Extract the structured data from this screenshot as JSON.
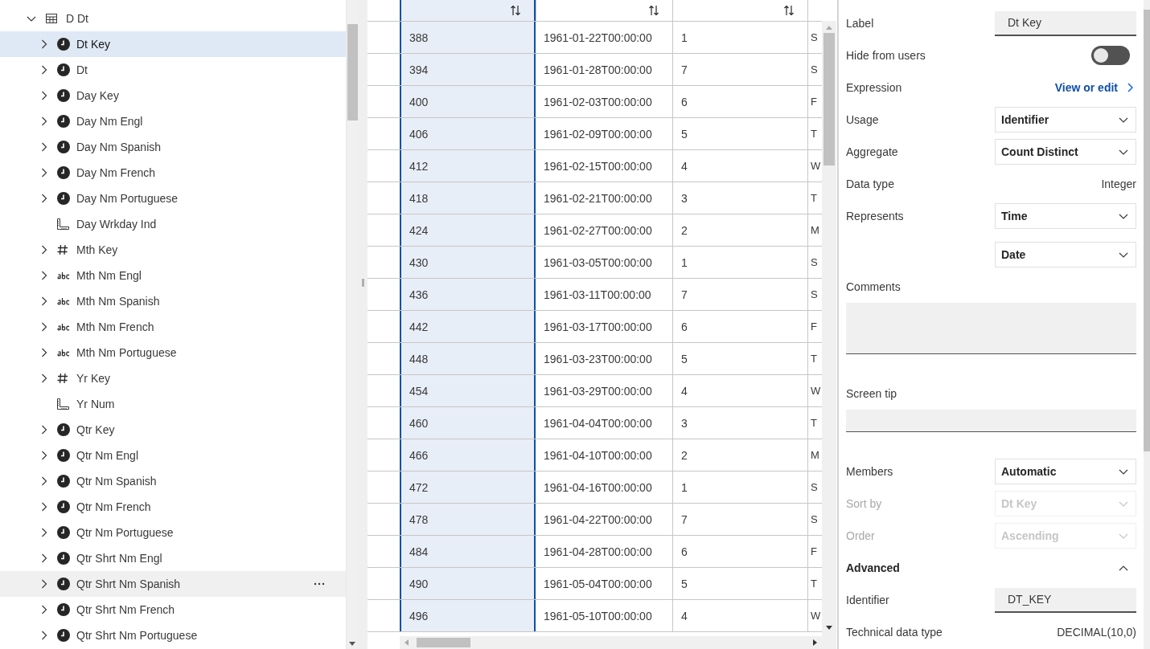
{
  "tree": {
    "label": "D Dt",
    "kind": "table",
    "expanded": true,
    "children": [
      {
        "label": "Dt Key",
        "kind": "clock",
        "expandable": true,
        "selected": true,
        "hovered": false
      },
      {
        "label": "Dt",
        "kind": "clock",
        "expandable": true,
        "selected": false,
        "hovered": false
      },
      {
        "label": "Day Key",
        "kind": "clock",
        "expandable": true,
        "selected": false,
        "hovered": false
      },
      {
        "label": "Day Nm Engl",
        "kind": "clock",
        "expandable": true,
        "selected": false,
        "hovered": false
      },
      {
        "label": "Day Nm Spanish",
        "kind": "clock",
        "expandable": true,
        "selected": false,
        "hovered": false
      },
      {
        "label": "Day Nm French",
        "kind": "clock",
        "expandable": true,
        "selected": false,
        "hovered": false
      },
      {
        "label": "Day Nm Portuguese",
        "kind": "clock",
        "expandable": true,
        "selected": false,
        "hovered": false
      },
      {
        "label": "Day Wrkday Ind",
        "kind": "ruler",
        "expandable": false,
        "selected": false,
        "hovered": false
      },
      {
        "label": "Mth Key",
        "kind": "hash",
        "expandable": true,
        "selected": false,
        "hovered": false
      },
      {
        "label": "Mth Nm Engl",
        "kind": "abc",
        "expandable": true,
        "selected": false,
        "hovered": false
      },
      {
        "label": "Mth Nm Spanish",
        "kind": "abc",
        "expandable": true,
        "selected": false,
        "hovered": false
      },
      {
        "label": "Mth Nm French",
        "kind": "abc",
        "expandable": true,
        "selected": false,
        "hovered": false
      },
      {
        "label": "Mth Nm Portuguese",
        "kind": "abc",
        "expandable": true,
        "selected": false,
        "hovered": false
      },
      {
        "label": "Yr Key",
        "kind": "hash",
        "expandable": true,
        "selected": false,
        "hovered": false
      },
      {
        "label": "Yr Num",
        "kind": "ruler",
        "expandable": false,
        "selected": false,
        "hovered": false
      },
      {
        "label": "Qtr Key",
        "kind": "clock",
        "expandable": true,
        "selected": false,
        "hovered": false
      },
      {
        "label": "Qtr Nm Engl",
        "kind": "clock",
        "expandable": true,
        "selected": false,
        "hovered": false
      },
      {
        "label": "Qtr Nm Spanish",
        "kind": "clock",
        "expandable": true,
        "selected": false,
        "hovered": false
      },
      {
        "label": "Qtr Nm French",
        "kind": "clock",
        "expandable": true,
        "selected": false,
        "hovered": false
      },
      {
        "label": "Qtr Nm Portuguese",
        "kind": "clock",
        "expandable": true,
        "selected": false,
        "hovered": false
      },
      {
        "label": "Qtr Shrt Nm Engl",
        "kind": "clock",
        "expandable": true,
        "selected": false,
        "hovered": false
      },
      {
        "label": "Qtr Shrt Nm Spanish",
        "kind": "clock",
        "expandable": true,
        "selected": false,
        "hovered": true
      },
      {
        "label": "Qtr Shrt Nm French",
        "kind": "clock",
        "expandable": true,
        "selected": false,
        "hovered": false
      },
      {
        "label": "Qtr Shrt Nm Portuguese",
        "kind": "clock",
        "expandable": true,
        "selected": false,
        "hovered": false
      }
    ]
  },
  "grid": {
    "columns": [
      {
        "selected": true,
        "sortable": true
      },
      {
        "selected": false,
        "sortable": true
      },
      {
        "selected": false,
        "sortable": true
      },
      {
        "selected": false,
        "sortable": false
      }
    ],
    "rows": [
      [
        "388",
        "1961-01-22T00:00:00",
        "1",
        "S"
      ],
      [
        "394",
        "1961-01-28T00:00:00",
        "7",
        "S"
      ],
      [
        "400",
        "1961-02-03T00:00:00",
        "6",
        "F"
      ],
      [
        "406",
        "1961-02-09T00:00:00",
        "5",
        "T"
      ],
      [
        "412",
        "1961-02-15T00:00:00",
        "4",
        "W"
      ],
      [
        "418",
        "1961-02-21T00:00:00",
        "3",
        "T"
      ],
      [
        "424",
        "1961-02-27T00:00:00",
        "2",
        "M"
      ],
      [
        "430",
        "1961-03-05T00:00:00",
        "1",
        "S"
      ],
      [
        "436",
        "1961-03-11T00:00:00",
        "7",
        "S"
      ],
      [
        "442",
        "1961-03-17T00:00:00",
        "6",
        "F"
      ],
      [
        "448",
        "1961-03-23T00:00:00",
        "5",
        "T"
      ],
      [
        "454",
        "1961-03-29T00:00:00",
        "4",
        "W"
      ],
      [
        "460",
        "1961-04-04T00:00:00",
        "3",
        "T"
      ],
      [
        "466",
        "1961-04-10T00:00:00",
        "2",
        "M"
      ],
      [
        "472",
        "1961-04-16T00:00:00",
        "1",
        "S"
      ],
      [
        "478",
        "1961-04-22T00:00:00",
        "7",
        "S"
      ],
      [
        "484",
        "1961-04-28T00:00:00",
        "6",
        "F"
      ],
      [
        "490",
        "1961-05-04T00:00:00",
        "5",
        "T"
      ],
      [
        "496",
        "1961-05-10T00:00:00",
        "4",
        "W"
      ]
    ]
  },
  "properties": [
    {
      "kind": "field",
      "label": "Label",
      "value": "Dt Key"
    },
    {
      "kind": "toggle",
      "label": "Hide from users",
      "on": false
    },
    {
      "kind": "link",
      "label": "Expression",
      "link": "View or edit"
    },
    {
      "kind": "select",
      "label": "Usage",
      "value": "Identifier",
      "disabled": false
    },
    {
      "kind": "select",
      "label": "Aggregate",
      "value": "Count Distinct",
      "disabled": false
    },
    {
      "kind": "value",
      "label": "Data type",
      "value": "Integer"
    },
    {
      "kind": "select",
      "label": "Represents",
      "value": "Time",
      "disabled": false
    },
    {
      "kind": "select",
      "value": "Date",
      "disabled": false
    },
    {
      "kind": "textarea",
      "label": "Comments"
    },
    {
      "kind": "textline",
      "label": "Screen tip"
    },
    {
      "kind": "select",
      "label": "Members",
      "value": "Automatic",
      "disabled": false
    },
    {
      "kind": "select",
      "label": "Sort by",
      "value": "Dt Key",
      "disabled": true
    },
    {
      "kind": "select",
      "label": "Order",
      "value": "Ascending",
      "disabled": true
    },
    {
      "kind": "section",
      "label": "Advanced",
      "expanded": true
    },
    {
      "kind": "field",
      "label": "Identifier",
      "value": "DT_KEY"
    },
    {
      "kind": "value",
      "label": "Technical data type",
      "value": "DECIMAL(10,0)"
    }
  ]
}
